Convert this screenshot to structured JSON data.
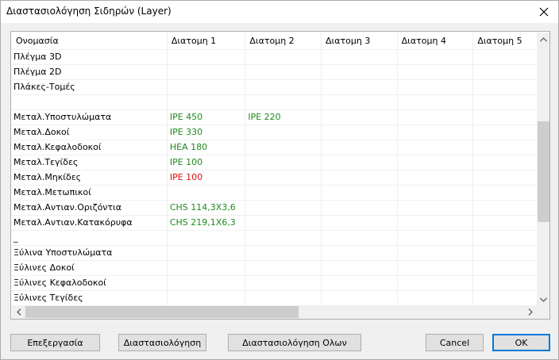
{
  "window": {
    "title": "Διαστασιολόγηση Σιδηρών (Layer)"
  },
  "colors": {
    "ok_value": "#1e8a1e",
    "fail_value": "#e01010",
    "accent": "#0078d7"
  },
  "grid": {
    "columns": [
      "Ονομασία",
      "Διατομη 1",
      "Διατομη 2",
      "Διατομη 3",
      "Διατομη 4",
      "Διατομη 5"
    ],
    "rows": [
      {
        "name": "Πλέγμα 3D",
        "cells": [
          {
            "text": "",
            "status": "none"
          },
          {
            "text": "",
            "status": "none"
          }
        ]
      },
      {
        "name": "Πλέγμα 2D",
        "cells": [
          {
            "text": "",
            "status": "none"
          },
          {
            "text": "",
            "status": "none"
          }
        ]
      },
      {
        "name": "Πλάκες-Τομές",
        "cells": [
          {
            "text": "",
            "status": "none"
          },
          {
            "text": "",
            "status": "none"
          }
        ]
      },
      {
        "name": "",
        "cells": [
          {
            "text": "",
            "status": "none"
          },
          {
            "text": "",
            "status": "none"
          }
        ]
      },
      {
        "name": "Μεταλ.Υποστυλώματα",
        "cells": [
          {
            "text": "IPE 450",
            "status": "ok"
          },
          {
            "text": "IPE 220",
            "status": "ok"
          }
        ]
      },
      {
        "name": "Μεταλ.Δοκοί",
        "cells": [
          {
            "text": "IPE 330",
            "status": "ok"
          },
          {
            "text": "",
            "status": "none"
          }
        ]
      },
      {
        "name": "Μεταλ.Κεφαλοδοκοί",
        "cells": [
          {
            "text": "HEA 180",
            "status": "ok"
          },
          {
            "text": "",
            "status": "none"
          }
        ]
      },
      {
        "name": "Μεταλ.Τεγίδες",
        "cells": [
          {
            "text": "IPE 100",
            "status": "ok"
          },
          {
            "text": "",
            "status": "none"
          }
        ]
      },
      {
        "name": "Μεταλ.Μηκίδες",
        "cells": [
          {
            "text": "IPE 100",
            "status": "fail"
          },
          {
            "text": "",
            "status": "none"
          }
        ]
      },
      {
        "name": "Μεταλ.Μετωπικοί",
        "cells": [
          {
            "text": "",
            "status": "none"
          },
          {
            "text": "",
            "status": "none"
          }
        ]
      },
      {
        "name": "Μεταλ.Αντιαν.Οριζόντια",
        "cells": [
          {
            "text": "CHS 114,3X3,6",
            "status": "ok"
          },
          {
            "text": "",
            "status": "none"
          }
        ]
      },
      {
        "name": "Μεταλ.Αντιαν.Κατακόρυφα",
        "cells": [
          {
            "text": "CHS 219,1X6,3",
            "status": "ok"
          },
          {
            "text": "",
            "status": "none"
          }
        ]
      },
      {
        "name": "_",
        "cells": [
          {
            "text": "",
            "status": "none"
          },
          {
            "text": "",
            "status": "none"
          }
        ]
      },
      {
        "name": "Ξύλινα Υποστυλώματα",
        "cells": [
          {
            "text": "",
            "status": "none"
          },
          {
            "text": "",
            "status": "none"
          }
        ]
      },
      {
        "name": "Ξύλινες Δοκοί",
        "cells": [
          {
            "text": "",
            "status": "none"
          },
          {
            "text": "",
            "status": "none"
          }
        ]
      },
      {
        "name": "Ξύλινες Κεφαλοδοκοί",
        "cells": [
          {
            "text": "",
            "status": "none"
          },
          {
            "text": "",
            "status": "none"
          }
        ]
      },
      {
        "name": "Ξύλινες Τεγίδες",
        "cells": [
          {
            "text": "",
            "status": "none"
          },
          {
            "text": "",
            "status": "none"
          }
        ]
      }
    ]
  },
  "buttons": {
    "edit": "Επεξεργασία",
    "design": "Διαστασιολόγηση",
    "design_all": "Διαστασιολόγηση Ολων",
    "cancel": "Cancel",
    "ok": "OK"
  },
  "icons": {
    "close": "close-icon",
    "scroll_up": "chevron-up-icon",
    "scroll_down": "chevron-down-icon",
    "scroll_left": "chevron-left-icon",
    "scroll_right": "chevron-right-icon"
  }
}
